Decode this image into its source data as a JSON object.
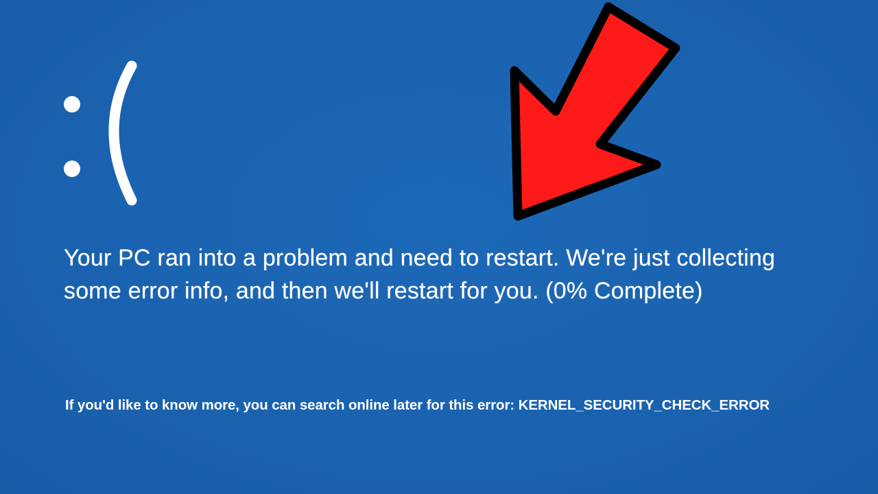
{
  "screen": {
    "background_color": "#1b64b2",
    "text_color": "#ffffff"
  },
  "sad_face": {
    "glyph": ":(",
    "icon": "sad-face-icon"
  },
  "message": {
    "text": "Your PC ran into a problem and need to restart. We're just collecting some error info, and then we'll restart for you. (0% Complete)",
    "progress_percent": 0
  },
  "more_info": {
    "text": "If you'd like to know more, you can search online later for this error: KERNEL_SECURITY_CHECK_ERROR",
    "error_code": "KERNEL_SECURITY_CHECK_ERROR"
  },
  "overlay": {
    "icon": "red-arrow-icon",
    "fill_color": "#ff1a1a",
    "outline_color": "#000000"
  }
}
